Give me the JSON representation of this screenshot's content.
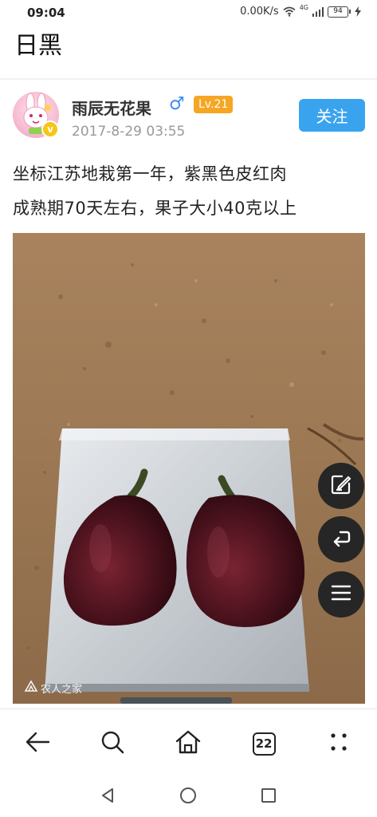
{
  "status_bar": {
    "time": "09:04",
    "net_speed": "0.00K/s",
    "network_type": "4G",
    "battery": "94"
  },
  "page": {
    "title": "日黑"
  },
  "post": {
    "author_name": "雨辰无花果",
    "gender_symbol": "♂",
    "level": "Lv.21",
    "verified_symbol": "v",
    "timestamp": "2017-8-29 03:55",
    "follow_label": "关注",
    "text_lines": [
      "坐标江苏地栽第一年，紫黑色皮红肉",
      "成熟期70天左右，果子大小40克以上"
    ],
    "photo_watermark": "农人之家"
  },
  "toolbar": {
    "tabs_count": "22"
  },
  "colors": {
    "accent_blue": "#3aa3ee",
    "level_orange": "#f6a623",
    "fab_dark": "#262626",
    "gender_blue": "#3d8bf2"
  },
  "icons": {
    "fab_1": "edit-icon",
    "fab_2": "reply-icon",
    "fab_3": "menu-icon",
    "toolbar": [
      "back-arrow-icon",
      "search-icon",
      "home-icon",
      "tabs-icon",
      "more-icon"
    ],
    "system_nav": [
      "nav-back-icon",
      "nav-home-icon",
      "nav-recents-icon"
    ]
  }
}
